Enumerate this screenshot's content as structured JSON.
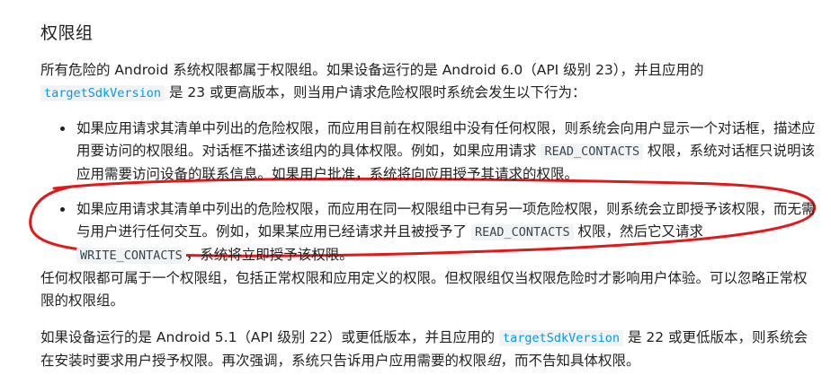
{
  "heading": "权限组",
  "para1": {
    "t1": "所有危险的 Android 系统权限都属于权限组。如果设备运行的是 Android 6.0（API 级别 23），并且应用的",
    "code1": "targetSdkVersion",
    "t2": " 是 23 或更高版本，则当用户请求危险权限时系统会发生以下行为："
  },
  "bullet1": {
    "t1": "如果应用请求其清单中列出的危险权限，而应用目前在权限组中没有任何权限，则系统会向用户显示一个对话框，描述应用要访问的权限组。对话框不描述该组内的具体权限。例如，如果应用请求 ",
    "code1": "READ_CONTACTS",
    "t2": " 权限，系统对话框只说明该应用需要访问设备的联系信息。如果用户批准，系统将向应用授予其请求的权限。"
  },
  "bullet2": {
    "t1": "如果应用请求其清单中列出的危险权限，而应用在同一权限组中已有另一项危险权限，则系统会立即授予该权限，而无需与用户进行任何交互。例如，如果某应用已经请求并且被授予了 ",
    "code1": "READ_CONTACTS",
    "t2": " 权限，然后它又请求 ",
    "code2": "WRITE_CONTACTS",
    "t3": "，系统将立即授予该权限。"
  },
  "para2": {
    "t1": "任何权限都可属于一个权限组，包括正常权限和应用定义的权限。但权限组仅当权限危险时才影响用户体验。可以忽略正常权限的权限组。"
  },
  "para3": {
    "t1": "如果设备运行的是 Android 5.1（API 级别 22）或更低版本，并且应用的 ",
    "code1": "targetSdkVersion",
    "t2": " 是 22 或更低版本，则系统会在安装时要求用户授予权限。再次强调，系统只告诉用户应用需要的权限",
    "em1": "组",
    "t3": "，而不告知具体权限。"
  },
  "colors": {
    "annotation": "#e0191b",
    "code_link": "#039be5",
    "code_bg": "#f1f3f4",
    "text": "#212121"
  }
}
